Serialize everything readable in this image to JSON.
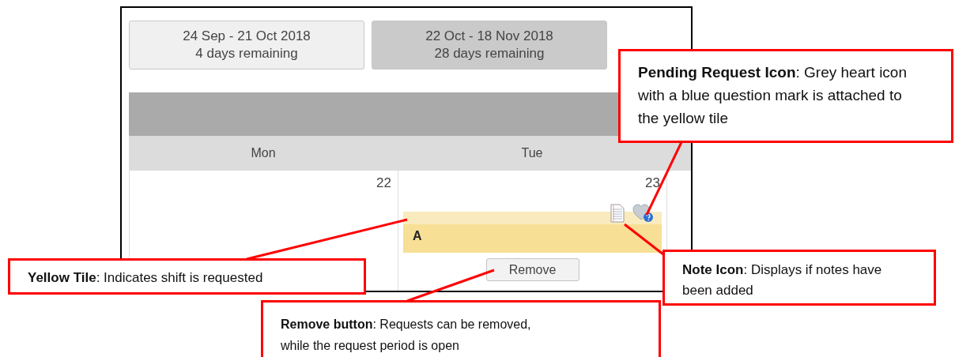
{
  "periods": [
    {
      "range": "24 Sep - 21 Oct 2018",
      "remaining": "4 days remaining",
      "selected": false
    },
    {
      "range": "22 Oct - 18 Nov 2018",
      "remaining": "28 days remaining",
      "selected": true
    }
  ],
  "calendar": {
    "days": [
      {
        "name": "Mon",
        "date": "22"
      },
      {
        "name": "Tue",
        "date": "23",
        "shift": {
          "label": "A",
          "has_note": true,
          "pending": true,
          "remove_label": "Remove"
        }
      }
    ]
  },
  "callouts": [
    {
      "text": "**Pending Request Icon**: Grey heart icon with a blue question mark is attached to the yellow tile"
    },
    {
      "text": "**Yellow Tile**: Indicates shift is requested"
    },
    {
      "text": "**Note Icon**: Displays if notes have been added"
    },
    {
      "text": "**Remove button**: Requests can be removed, while the request period is open"
    }
  ]
}
